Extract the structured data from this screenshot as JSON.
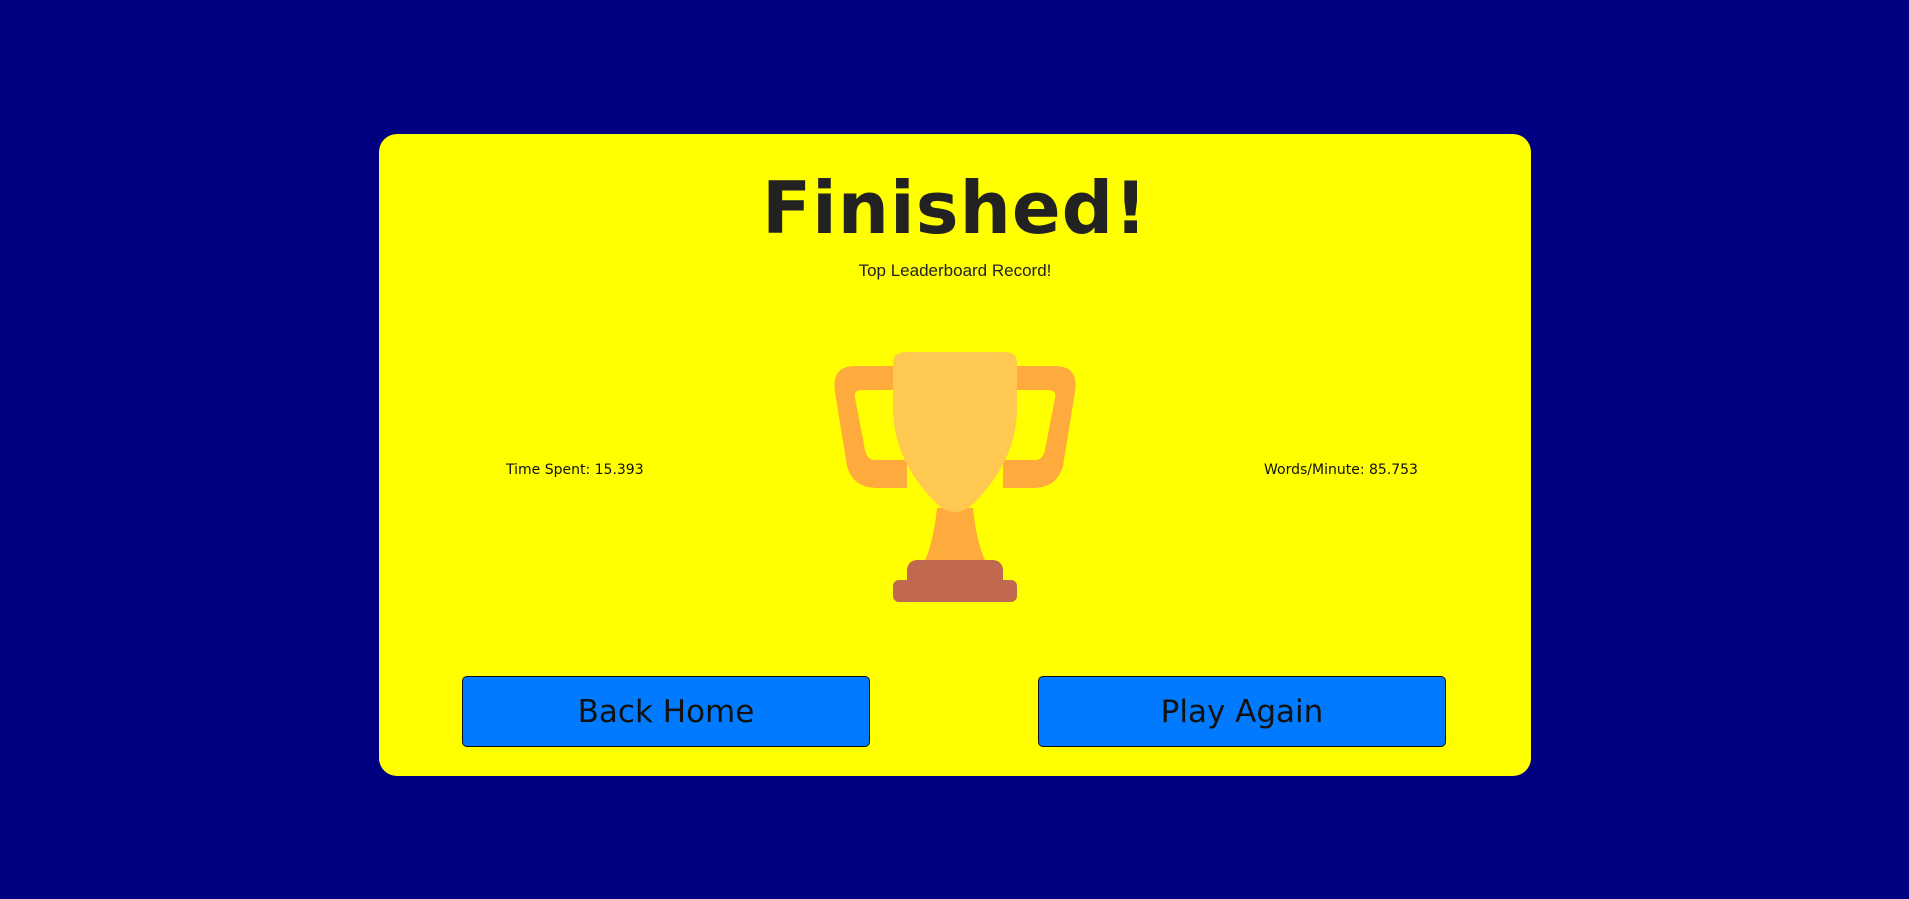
{
  "results": {
    "title": "Finished!",
    "subtitle": "Top Leaderboard Record!",
    "time_spent": "Time Spent: 15.393",
    "words_per_minute": "Words/Minute: 85.753",
    "trophy_icon": "trophy-icon"
  },
  "actions": {
    "back_home_label": "Back Home",
    "play_again_label": "Play Again"
  },
  "colors": {
    "background": "#000080",
    "card": "#ffff00",
    "button": "#007bff",
    "trophy_cup": "#ffc850",
    "trophy_handles": "#ffaa3c",
    "trophy_base": "#c0694e"
  }
}
